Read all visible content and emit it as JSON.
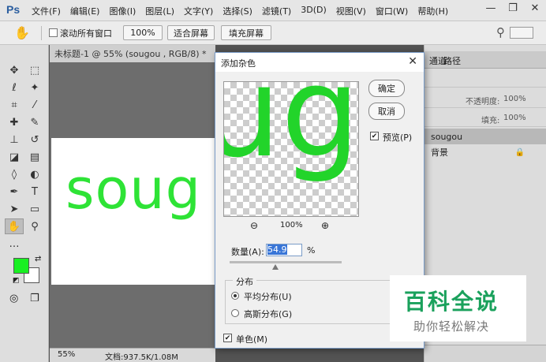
{
  "app": {
    "logo": "Ps"
  },
  "menu": [
    "文件(F)",
    "编辑(E)",
    "图像(I)",
    "图层(L)",
    "文字(Y)",
    "选择(S)",
    "滤镜(T)",
    "3D(D)",
    "视图(V)",
    "窗口(W)",
    "帮助(H)"
  ],
  "window_controls": {
    "minimize": "—",
    "restore": "❐",
    "close": "✕"
  },
  "options": {
    "scroll_all_label": "滚动所有窗口",
    "zoom_value": "100%",
    "fit_screen": "适合屏幕",
    "fill_screen": "填充屏幕"
  },
  "document": {
    "tab": "未标题-1 @ 55% (sougou , RGB/8) *",
    "canvas_text": "soug",
    "status_zoom": "55%",
    "status_doc": "文档:937.5K/1.08M"
  },
  "colors": {
    "foreground": "#19f022",
    "background": "#ffffff",
    "accent": "#1aa15c"
  },
  "right_panel": {
    "tabs": [
      "通道",
      "路径"
    ],
    "opacity_label": "不透明度:",
    "opacity_value": "100%",
    "fill_label": "填充:",
    "fill_value": "100%",
    "layers": [
      {
        "name": "sougou",
        "selected": true
      },
      {
        "name": "背景",
        "locked": true
      }
    ]
  },
  "dialog": {
    "title": "添加杂色",
    "ok": "确定",
    "cancel": "取消",
    "preview_label": "预览(P)",
    "preview_checked": true,
    "preview_text": "ug",
    "zoom": "100%",
    "amount_label": "数量(A):",
    "amount_value": "54.9",
    "amount_unit": "%",
    "distribution_label": "分布",
    "uniform_label": "平均分布(U)",
    "gaussian_label": "高斯分布(G)",
    "distribution_selected": "uniform",
    "monochrome_label": "单色(M)",
    "monochrome_checked": true
  },
  "watermark": {
    "main": "百科全说",
    "sub": "助你轻松解决"
  }
}
